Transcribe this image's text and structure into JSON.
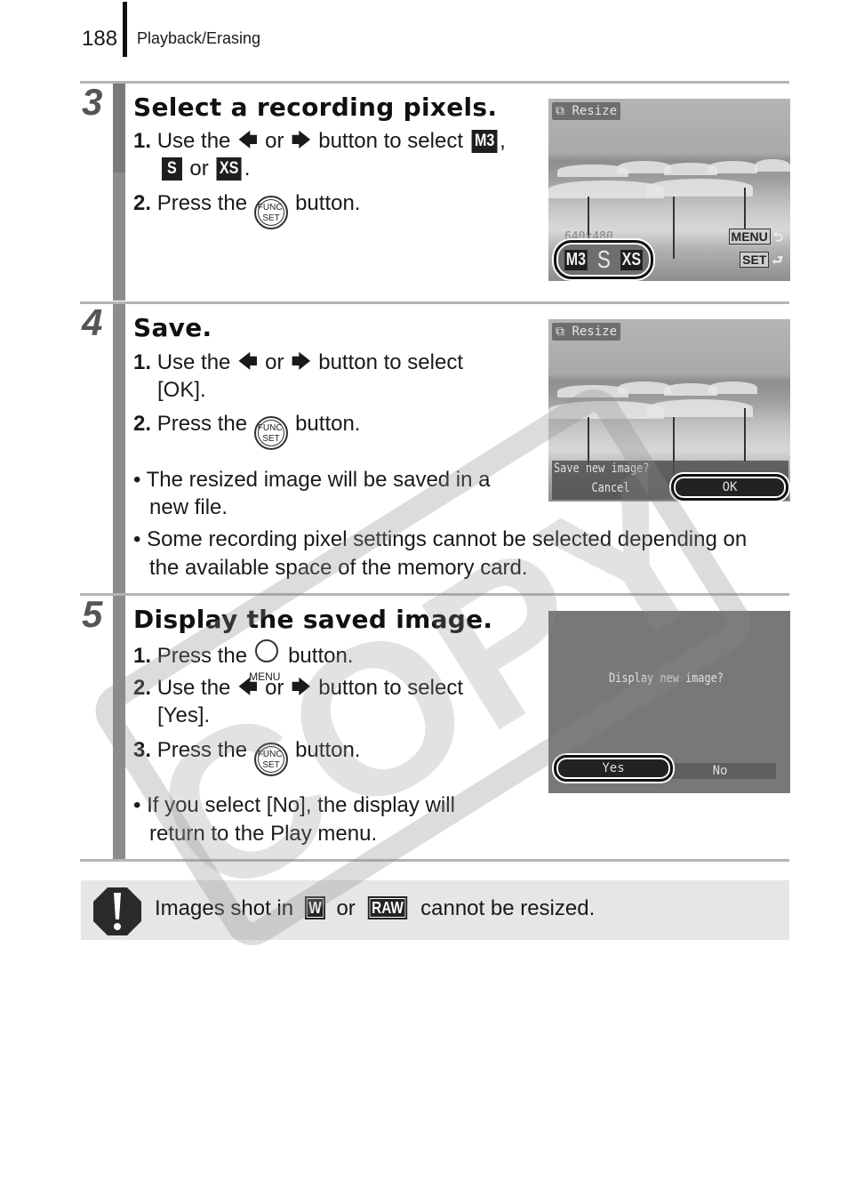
{
  "header": {
    "page_number": "188",
    "section": "Playback/Erasing"
  },
  "steps": [
    {
      "number": "3",
      "title": "Select a recording pixels.",
      "instructions": [
        {
          "num": "1.",
          "pre": "Use the",
          "mid": "or",
          "post": "button to select",
          "badge1": "M3",
          "sep1": ",",
          "badge2": "S",
          "or": "or",
          "badge3": "XS",
          "end": "."
        },
        {
          "num": "2.",
          "pre": "Press the",
          "button": "FUNC. SET",
          "post": "button."
        }
      ],
      "screen": {
        "label": "Resize",
        "resolution": "640x480",
        "sizes": [
          "M3",
          "S",
          "XS"
        ],
        "selected_size": "S",
        "menu_key": "MENU",
        "set_key": "SET"
      }
    },
    {
      "number": "4",
      "title": "Save.",
      "instructions": [
        {
          "num": "1.",
          "pre": "Use the",
          "mid": "or",
          "post": "button to select",
          "cont": "[OK]."
        },
        {
          "num": "2.",
          "pre": "Press the",
          "button": "FUNC. SET",
          "post": "button."
        }
      ],
      "bullets": [
        {
          "line1": "The resized image will be saved in a",
          "line2": "new file."
        },
        {
          "line1": "Some recording pixel settings cannot be selected depending on",
          "line2": "the available space of the memory card."
        }
      ],
      "screen": {
        "label": "Resize",
        "prompt": "Save new image?",
        "options": [
          "Cancel",
          "OK"
        ],
        "selected": "OK"
      }
    },
    {
      "number": "5",
      "title": "Display the saved image.",
      "instructions": [
        {
          "num": "1.",
          "pre": "Press the",
          "button": "MENU",
          "post": "button."
        },
        {
          "num": "2.",
          "pre": "Use the",
          "mid": "or",
          "post": "button to select",
          "cont": "[Yes]."
        },
        {
          "num": "3.",
          "pre": "Press the",
          "button": "FUNC. SET",
          "post": "button."
        }
      ],
      "bullets": [
        {
          "line1": "If you select [No], the display will",
          "line2": "return to the Play menu."
        }
      ],
      "screen": {
        "prompt": "Display new image?",
        "options": [
          "Yes",
          "No"
        ],
        "selected": "Yes"
      }
    }
  ],
  "note": {
    "pre": "Images shot in",
    "badge1": "W",
    "or": "or",
    "badge2": "RAW",
    "post": "cannot be resized."
  },
  "watermark": "COPY",
  "icons": {
    "left": "◆",
    "right": "◆",
    "func_top": "FUNC.",
    "func_bottom": "SET"
  }
}
